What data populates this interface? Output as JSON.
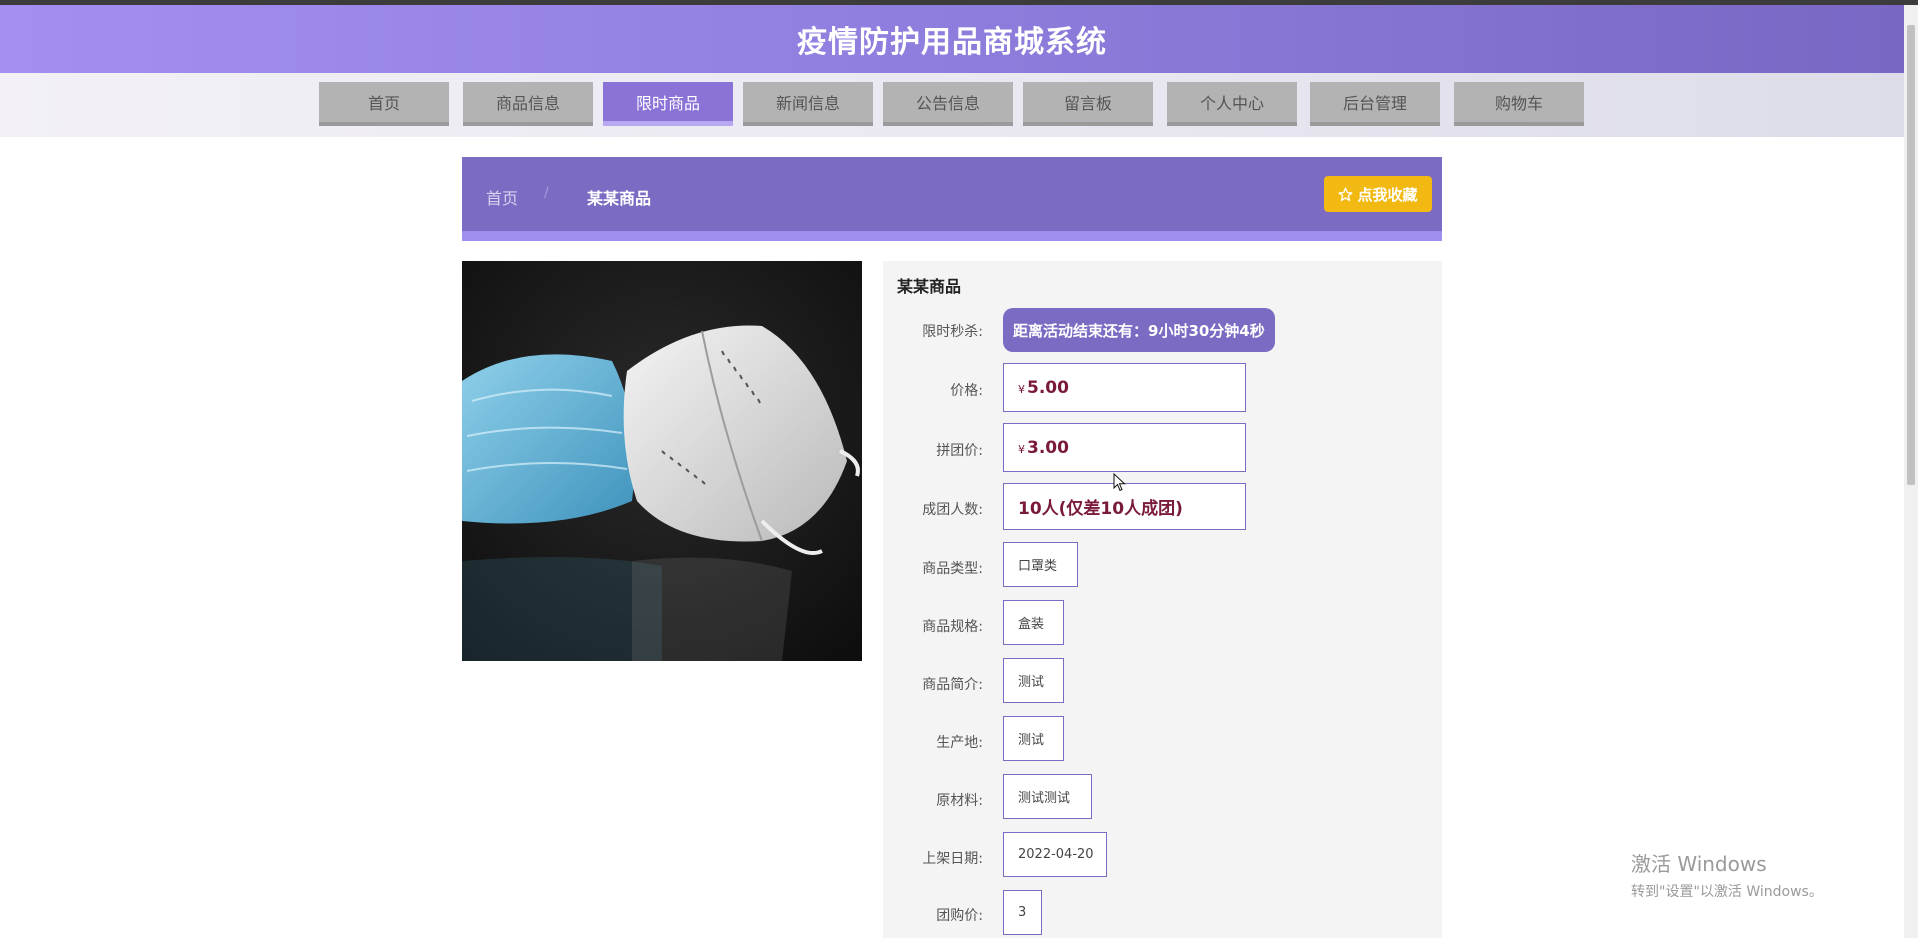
{
  "header": {
    "title": "疫情防护用品商城系统"
  },
  "nav": {
    "items": [
      {
        "label": "首页"
      },
      {
        "label": "商品信息"
      },
      {
        "label": "限时商品"
      },
      {
        "label": "新闻信息"
      },
      {
        "label": "公告信息"
      },
      {
        "label": "留言板"
      },
      {
        "label": "个人中心"
      },
      {
        "label": "后台管理"
      },
      {
        "label": "购物车"
      }
    ],
    "active_index": 2
  },
  "breadcrumb": {
    "home": "首页",
    "separator": "/",
    "current": "某某商品"
  },
  "favorite_button": {
    "label": "点我收藏",
    "icon": "star-outline-icon"
  },
  "product": {
    "image_alt": "",
    "name": "某某商品",
    "flash_label": "限时秒杀:",
    "countdown": "距离活动结束还有：9小时30分钟4秒",
    "fields": [
      {
        "label": "价格:",
        "currency": "¥",
        "value": "5.00"
      },
      {
        "label": "拼团价:",
        "currency": "¥",
        "value": "3.00"
      },
      {
        "label": "成团人数:",
        "value": "10人(仅差10人成团)"
      },
      {
        "label": "商品类型:",
        "value": "口罩类"
      },
      {
        "label": "商品规格:",
        "value": "盒装"
      },
      {
        "label": "商品简介:",
        "value": "测试"
      },
      {
        "label": "生产地:",
        "value": "测试"
      },
      {
        "label": "原材料:",
        "value": "测试测试"
      },
      {
        "label": "上架日期:",
        "value": "2022-04-20"
      },
      {
        "label": "团购价:",
        "value": "3"
      }
    ]
  },
  "watermark": {
    "line1": "激活 Windows",
    "line2": "转到\"设置\"以激活 Windows。"
  },
  "colors": {
    "accent": "#7b6bc3",
    "header_start": "#a58ef2",
    "fav_button": "#f3b913",
    "price": "#7a1a3a"
  }
}
